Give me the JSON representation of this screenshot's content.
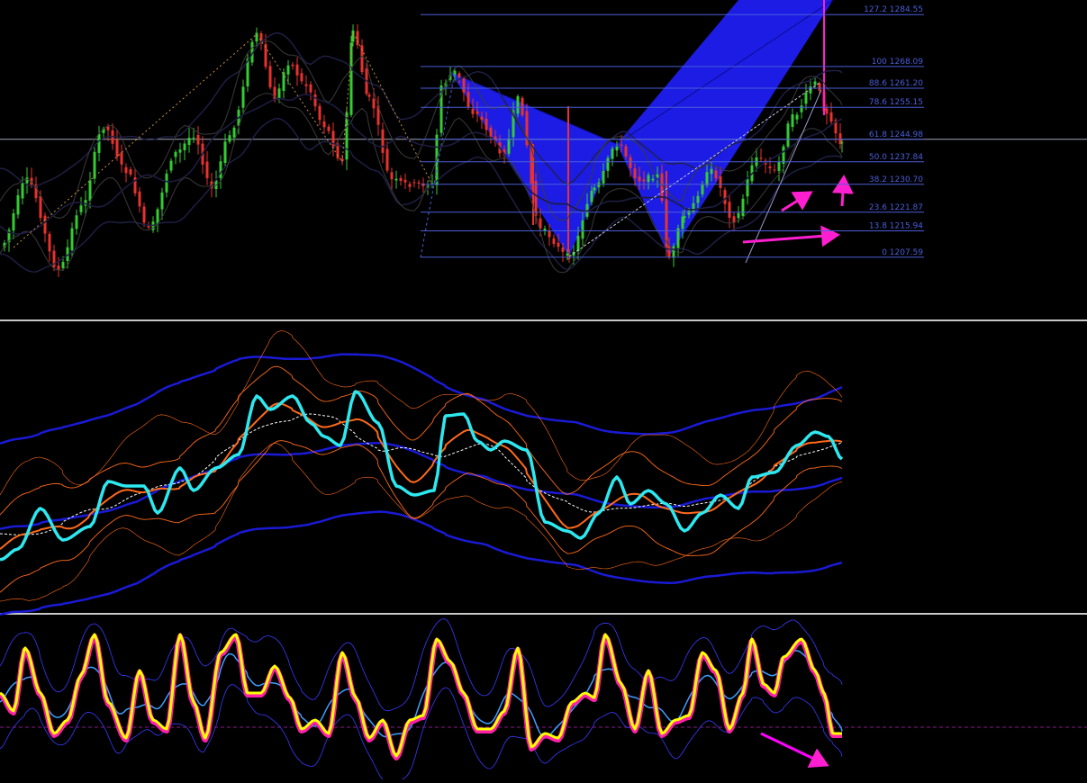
{
  "chart_data": [
    {
      "type": "candlestick",
      "panel": "price",
      "fibonacci_levels": [
        {
          "label": "127.2 1284.55",
          "ratio": 127.2,
          "price": 1284.55
        },
        {
          "label": "100 1268.09",
          "ratio": 100,
          "price": 1268.09
        },
        {
          "label": "88.6 1261.20",
          "ratio": 88.6,
          "price": 1261.2
        },
        {
          "label": "78.6 1255.15",
          "ratio": 78.6,
          "price": 1255.15
        },
        {
          "label": "61.8 1244.98",
          "ratio": 61.8,
          "price": 1244.98
        },
        {
          "label": "50.0 1237.84",
          "ratio": 50.0,
          "price": 1237.84
        },
        {
          "label": "38.2 1230.70",
          "ratio": 38.2,
          "price": 1230.7
        },
        {
          "label": "23.6 1221.87",
          "ratio": 23.6,
          "price": 1221.87
        },
        {
          "label": "13.8 1215.94",
          "ratio": 13.8,
          "price": 1215.94
        },
        {
          "label": "0 1207.59",
          "ratio": 0,
          "price": 1207.59
        }
      ],
      "horizontal_line_price": 1244.98,
      "harmonic_pattern_color": "#1e1ef0",
      "bull_color": "#33cc33",
      "bear_color": "#e8322e",
      "fib_color": "#4a5ed8",
      "annotation_color": "#ff1fd1",
      "grid": false
    },
    {
      "type": "line",
      "panel": "oscillator-1",
      "series_colors": [
        "#1a1ad6",
        "#ff6a1a",
        "#ffffff",
        "#2ee8f0"
      ]
    },
    {
      "type": "line",
      "panel": "oscillator-2",
      "series_colors": [
        "#ffff00",
        "#ff1fa8",
        "#3ba0ff",
        "#3a3aff",
        "#ff00ff"
      ]
    }
  ]
}
